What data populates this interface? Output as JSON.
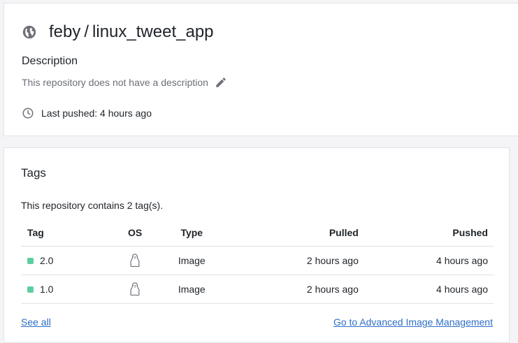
{
  "repo": {
    "owner": "feby",
    "separator": "/",
    "name": "linux_tweet_app",
    "visibility_icon": "globe-icon"
  },
  "description": {
    "heading": "Description",
    "text": "This repository does not have a description",
    "edit_icon": "pencil-icon"
  },
  "last_pushed": {
    "icon": "clock-icon",
    "text": "Last pushed: 4 hours ago"
  },
  "tags": {
    "heading": "Tags",
    "count_text": "This repository contains 2 tag(s).",
    "columns": [
      "Tag",
      "OS",
      "Type",
      "Pulled",
      "Pushed"
    ],
    "rows": [
      {
        "tag": "2.0",
        "os_icon": "linux-icon",
        "type": "Image",
        "pulled": "2 hours ago",
        "pushed": "4 hours ago"
      },
      {
        "tag": "1.0",
        "os_icon": "linux-icon",
        "type": "Image",
        "pulled": "2 hours ago",
        "pushed": "4 hours ago"
      }
    ],
    "see_all": "See all",
    "advanced_link": "Go to Advanced Image Management"
  },
  "colors": {
    "tag_dot": "#5ccfa0",
    "link": "#2e6ec8",
    "muted_text": "#6c6f78"
  }
}
